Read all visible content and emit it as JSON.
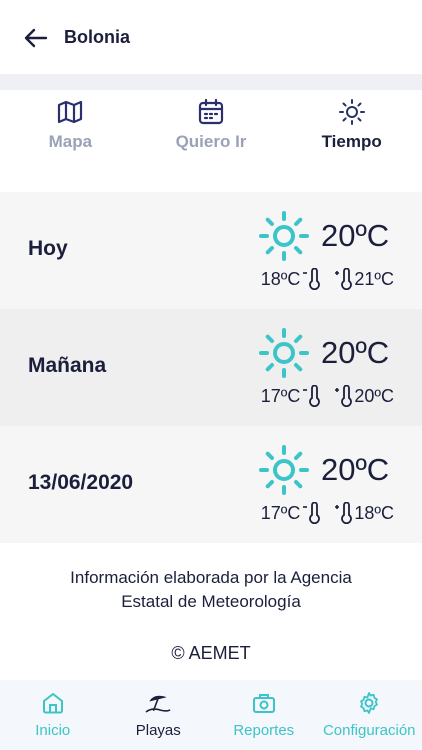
{
  "header": {
    "title": "Bolonia",
    "back_icon": "arrow-left-icon"
  },
  "tabs": [
    {
      "label": "Mapa",
      "icon": "map-icon",
      "active": false
    },
    {
      "label": "Quiero Ir",
      "icon": "calendar-icon",
      "active": false
    },
    {
      "label": "Tiempo",
      "icon": "sun-icon",
      "active": true
    }
  ],
  "forecast": [
    {
      "day": "Hoy",
      "temp": "20ºC",
      "min": "18ºC",
      "max": "21ºC",
      "icon": "sun-icon"
    },
    {
      "day": "Mañana",
      "temp": "20ºC",
      "min": "17ºC",
      "max": "20ºC",
      "icon": "sun-icon"
    },
    {
      "day": "13/06/2020",
      "temp": "20ºC",
      "min": "17ºC",
      "max": "18ºC",
      "icon": "sun-icon"
    }
  ],
  "info": {
    "line1": "Información elaborada por la Agencia",
    "line2": "Estatal de Meteorología",
    "copyright": "© AEMET"
  },
  "bottom_nav": [
    {
      "label": "Inicio",
      "icon": "home-icon",
      "active": false
    },
    {
      "label": "Playas",
      "icon": "beach-umbrella-icon",
      "active": true
    },
    {
      "label": "Reportes",
      "icon": "camera-icon",
      "active": false
    },
    {
      "label": "Configuración",
      "icon": "gear-icon",
      "active": false
    }
  ],
  "colors": {
    "accent": "#3cc5c8",
    "navy": "#1b1f3b",
    "tab_underline": "#2b2f6e",
    "muted": "#9aa2b8"
  }
}
